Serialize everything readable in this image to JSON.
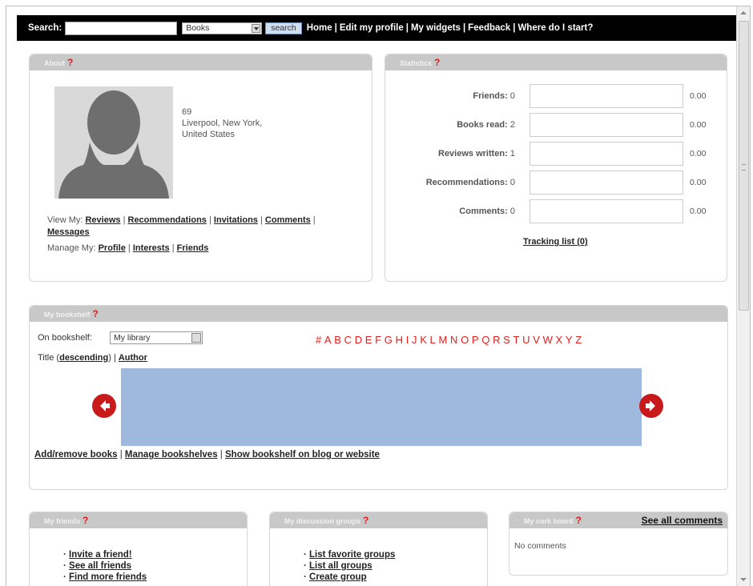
{
  "topbar": {
    "search_label": "Search:",
    "search_value": "",
    "search_category": "Books",
    "search_button": "search",
    "nav": [
      "Home",
      "Edit my profile",
      "My widgets",
      "Feedback",
      "Where do I start?"
    ],
    "separator": "|"
  },
  "about": {
    "title": "About",
    "help": "?",
    "age": "69",
    "location_line1": "Liverpool, New York,",
    "location_line2": "United States",
    "view_label": "View My:",
    "view_links": [
      "Reviews",
      "Recommendations",
      "Invitations",
      "Comments",
      "Messages"
    ],
    "manage_label": "Manage My:",
    "manage_links": [
      "Profile",
      "Interests",
      "Friends"
    ]
  },
  "statistics": {
    "title": "Statistics",
    "help": "?",
    "rows": [
      {
        "label": "Friends:",
        "value": "0",
        "ratio": "0.00"
      },
      {
        "label": "Books read:",
        "value": "2",
        "ratio": "0.00"
      },
      {
        "label": "Reviews written:",
        "value": "1",
        "ratio": "0.00"
      },
      {
        "label": "Recommendations:",
        "value": "0",
        "ratio": "0.00"
      },
      {
        "label": "Comments:",
        "value": "0",
        "ratio": "0.00"
      }
    ],
    "tracking_link": "Tracking list (0)"
  },
  "bookshelf": {
    "title": "My bookshelf",
    "help": "?",
    "on_label": "On bookshelf:",
    "selected_shelf": "My library",
    "alphabet": [
      "#",
      "A",
      "B",
      "C",
      "D",
      "E",
      "F",
      "G",
      "H",
      "I",
      "J",
      "K",
      "L",
      "M",
      "N",
      "O",
      "P",
      "Q",
      "R",
      "S",
      "T",
      "U",
      "V",
      "W",
      "X",
      "Y",
      "Z"
    ],
    "sort_prefix": "Title (",
    "sort_desc": "descending",
    "sort_mid": ") |",
    "sort_author": "Author",
    "links": [
      "Add/remove books",
      "Manage bookshelves",
      "Show bookshelf on blog or website"
    ],
    "colors": {
      "shelf_background": "#9fb8dd",
      "arrow": "#c8191b",
      "alphabet": "#e01c1c"
    }
  },
  "friends": {
    "title": "My friends",
    "help": "?",
    "items": [
      "Invite a friend!",
      "See all friends",
      "Find more friends"
    ]
  },
  "groups": {
    "title": "My discussion groups",
    "help": "?",
    "items": [
      "List favorite groups",
      "List all groups",
      "Create group"
    ]
  },
  "corkboard": {
    "title": "My cork board",
    "help": "?",
    "see_all": "See all comments",
    "empty": "No comments"
  }
}
